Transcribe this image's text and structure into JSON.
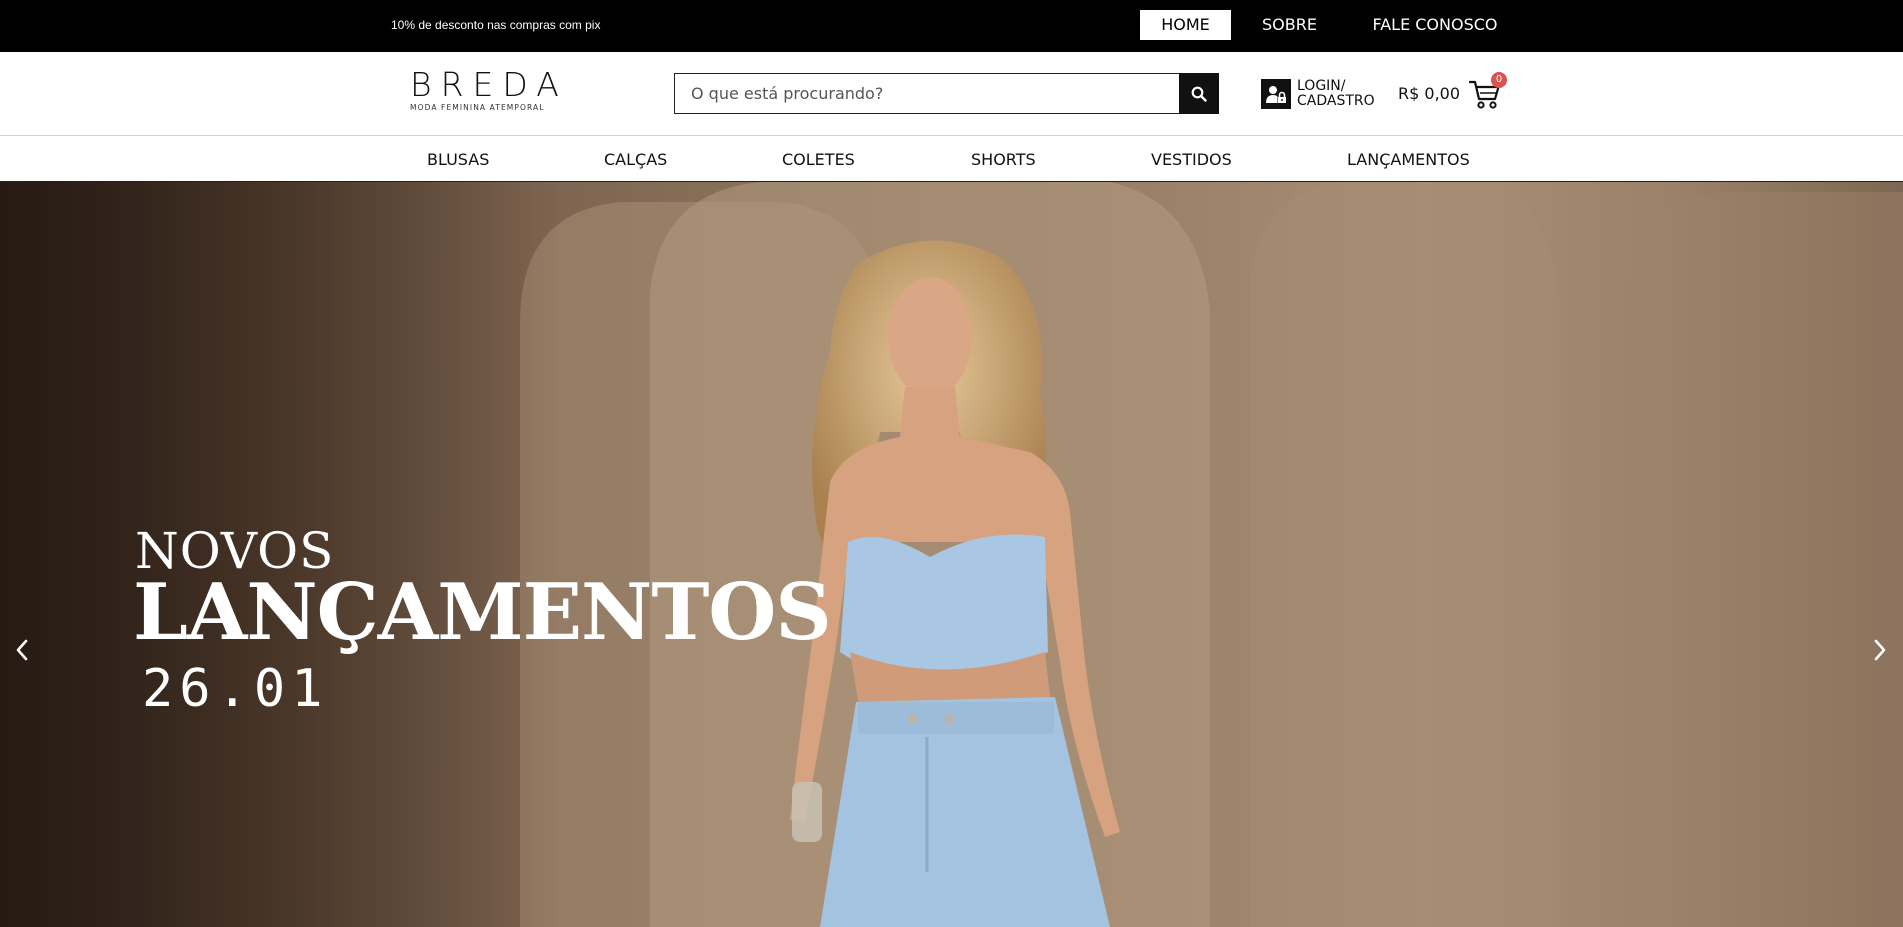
{
  "topbar": {
    "promo": "10% de desconto nas compras com pix",
    "links": [
      {
        "label": "HOME",
        "active": true
      },
      {
        "label": "SOBRE",
        "active": false
      },
      {
        "label": "FALE CONOSCO",
        "active": false
      }
    ]
  },
  "header": {
    "logo": {
      "name": "BREDA",
      "tagline": "MODA FEMININA ATEMPORAL"
    },
    "search": {
      "placeholder": "O que está procurando?",
      "value": "",
      "icon": "search-icon"
    },
    "login": {
      "line1": "LOGIN/",
      "line2": "CADASTRO",
      "icon": "user-lock-icon"
    },
    "cart": {
      "total": "R$ 0,00",
      "count": "0",
      "icon": "cart-icon"
    }
  },
  "categories": [
    "BLUSAS",
    "CALÇAS",
    "COLETES",
    "SHORTS",
    "VESTIDOS",
    "LANÇAMENTOS"
  ],
  "hero": {
    "kicker": "NOVOS",
    "title": "LANÇAMENTOS",
    "date": "26.01",
    "prev_icon": "chevron-left-icon",
    "next_icon": "chevron-right-icon"
  },
  "colors": {
    "topbar": "#000000",
    "badge": "#d9534f",
    "hero_wall": "#9a8068",
    "outfit": "#a9c7e2"
  }
}
